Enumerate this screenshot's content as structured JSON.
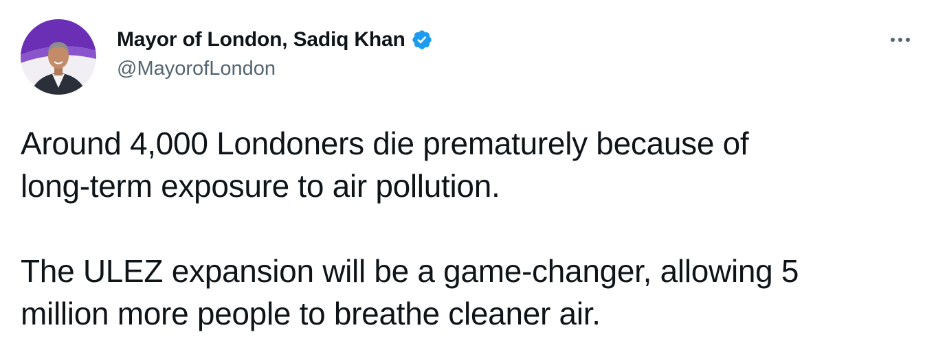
{
  "tweet": {
    "author": {
      "display_name": "Mayor of London, Sadiq Khan",
      "handle": "@MayorofLondon",
      "verified": true,
      "avatar_icon": "profile-photo"
    },
    "menu_icon": "more-horizontal-icon",
    "paragraphs": [
      {
        "lines": [
          "Around 4,000 Londoners die prematurely because of",
          "long-term exposure to air pollution."
        ]
      },
      {
        "lines": [
          "The ULEZ expansion will be a game-changer, allowing 5",
          "million more people to breathe cleaner air."
        ]
      }
    ]
  },
  "colors": {
    "text": "#0f1419",
    "secondary_text": "#536471",
    "verified_blue": "#1d9bf0",
    "avatar_banner_purple": "#6b2fb5"
  }
}
